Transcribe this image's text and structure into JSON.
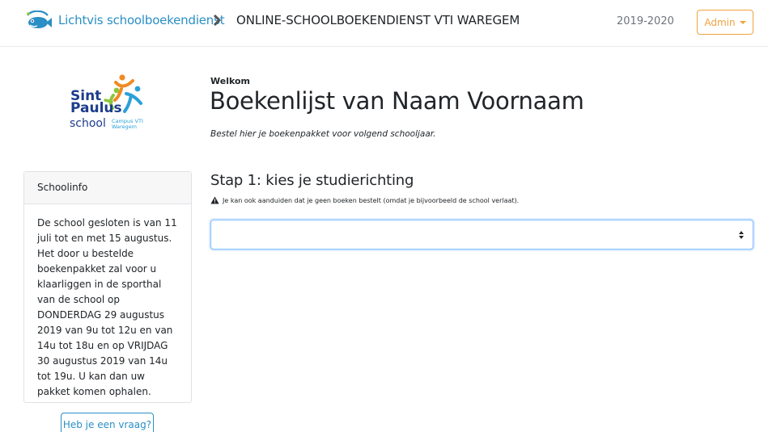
{
  "navbar": {
    "brand_name": "Lichtvis schoolboekendienst",
    "school_title": "ONLINE-SCHOOLBOEKENDIENST VTI WAREGEM",
    "year": "2019-2020",
    "admin_label": "Admin"
  },
  "school_logo": {
    "line1": "Sint",
    "line2": "Paulus",
    "line3": "school",
    "campus_line1": "Campus VTI",
    "campus_line2": "Waregem"
  },
  "header": {
    "welcome": "Welkom",
    "title": "Boekenlijst van Naam Voornaam",
    "subtitle": "Bestel hier je boekenpakket voor volgend schooljaar."
  },
  "schoolinfo": {
    "title": "Schoolinfo",
    "body": "De school gesloten is van 11 juli tot en met 15 augustus. Het door u bestelde boekenpakket zal voor u klaarliggen in de sporthal van de school op DONDERDAG 29 augustus 2019 van 9u tot 12u en van 14u tot 18u en op VRIJDAG 30 augustus 2019 van 14u tot 19u. U kan dan uw pakket komen ophalen."
  },
  "help_button": "Heb je een vraag?",
  "step": {
    "title": "Stap 1: kies je studierichting",
    "notice": "Je kan ook aanduiden dat je geen boeken bestelt (omdat je bijvoorbeeld de school verlaat).",
    "select_value": ""
  },
  "colors": {
    "brand_blue": "#2a8fc4",
    "admin_orange": "#f0a341",
    "logo_navy": "#1d3c8c",
    "logo_orange": "#f08a24",
    "logo_green": "#8cc63f"
  }
}
